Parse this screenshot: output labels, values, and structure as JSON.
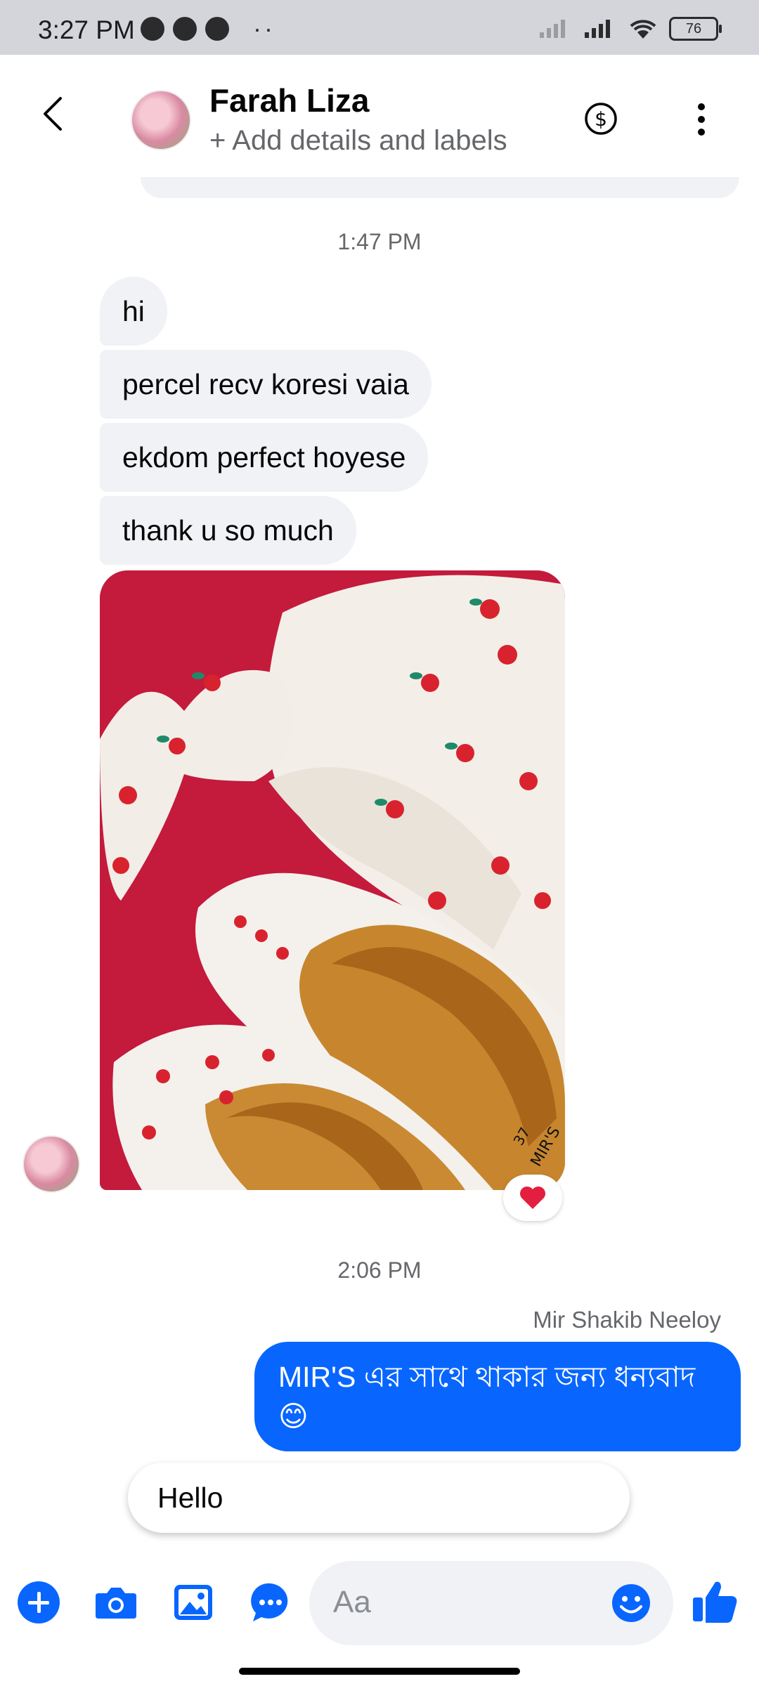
{
  "status_bar": {
    "time": "3:27 PM",
    "dots": "··",
    "battery": "76"
  },
  "header": {
    "contact_name": "Farah Liza",
    "subtitle": "+ Add details and labels"
  },
  "messages": {
    "timestamp_1": "1:47 PM",
    "incoming": [
      "hi",
      "percel recv koresi vaia",
      "ekdom perfect hoyese",
      "thank u so much"
    ],
    "reaction": "❤️",
    "timestamp_2": "2:06 PM",
    "outgoing_sender": "Mir Shakib Neeloy",
    "outgoing_text": "MIR'S এর সাথে থাকার জন্য ধন্যবাদ 😊",
    "photo_brand": "MIR'S",
    "photo_size": "37"
  },
  "quick_reply": "Hello",
  "composer": {
    "placeholder": "Aa"
  },
  "colors": {
    "accent": "#0866ff",
    "bubble_in": "#f0f2f5",
    "reaction": "#e41e3f"
  }
}
